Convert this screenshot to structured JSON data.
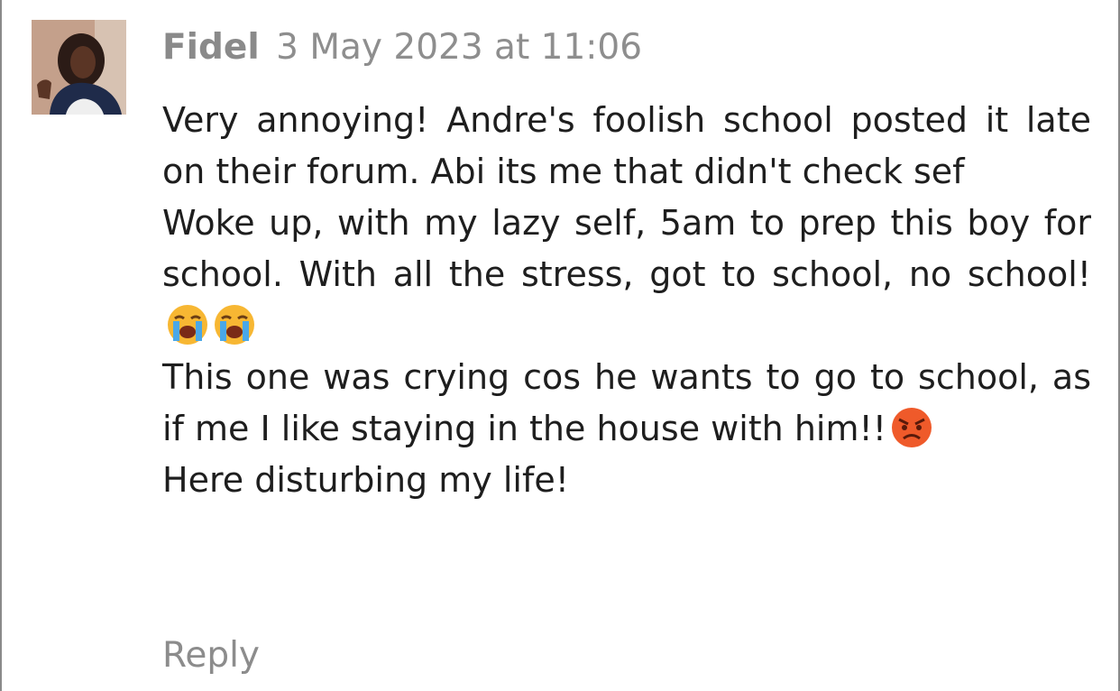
{
  "comment": {
    "author": "Fidel",
    "timestamp": "3 May 2023 at 11:06",
    "avatar_icon": "user-profile-photo",
    "paragraphs": [
      "Very annoying! Andre's foolish school posted it late on their forum. Abi its me that didn't check sef",
      "Woke up, with my lazy self, 5am to prep this boy for school. With all the stress, got to school, no school!",
      "This one was crying cos he wants to go to school, as if me I like staying in the house with him!!",
      "Here disturbing my life!"
    ],
    "emojis": {
      "crying_face": "loudly-crying-face-emoji",
      "angry_face": "angry-face-emoji"
    },
    "reply_label": "Reply"
  },
  "colors": {
    "meta_text": "#8e8e8e",
    "body_text": "#1e1e1e",
    "border": "#8a8a8a",
    "emoji_face": "#f7b733",
    "angry_face": "#ef5a2a"
  }
}
